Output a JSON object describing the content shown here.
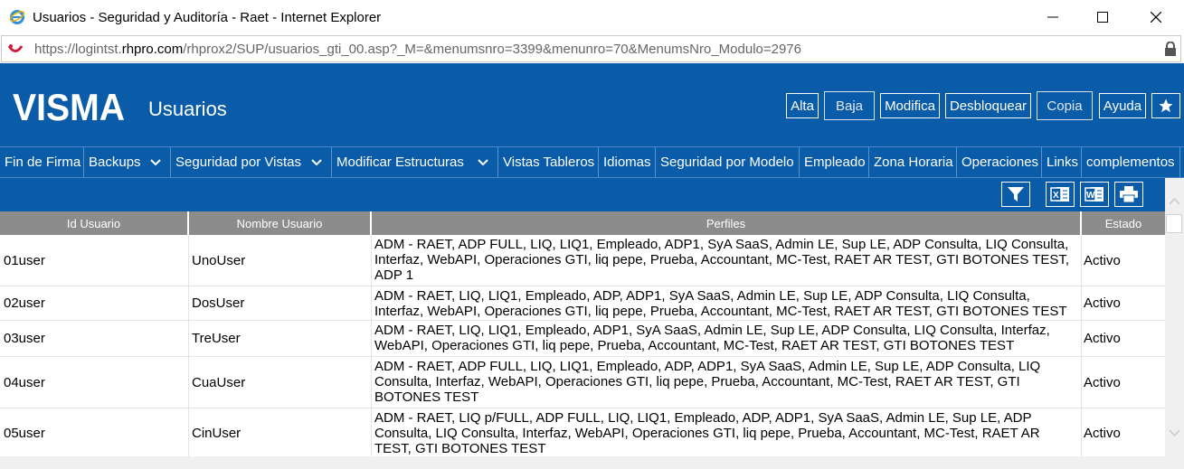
{
  "window": {
    "title": "Usuarios - Seguridad y Auditoría - Raet - Internet Explorer",
    "controls": [
      "minimize-icon",
      "maximize-icon",
      "close-icon"
    ]
  },
  "address": {
    "url_prefix": "https://logintst.",
    "url_host": "rhpro.com",
    "url_rest": "/rhprox2/SUP/usuarios_gti_00.asp?_M=&menumsnro=3399&menunro=70&MenumsNro_Modulo=2976",
    "icon": "site-icon",
    "lock_icon": "lock-icon"
  },
  "header": {
    "logo": "VISMA",
    "title": "Usuarios",
    "buttons": {
      "alta": "Alta",
      "baja": "Baja",
      "modifica": "Modifica",
      "desbloquear": "Desbloquear",
      "copia": "Copia",
      "ayuda": "Ayuda"
    },
    "favorite_icon": "star-icon"
  },
  "nav": {
    "items": [
      {
        "label": "Fin de Firma"
      },
      {
        "label": "Backups"
      },
      {
        "label": "Seguridad por Vistas"
      },
      {
        "label": "Modificar Estructuras"
      },
      {
        "label": "Vistas Tableros"
      },
      {
        "label": "Idiomas"
      },
      {
        "label": "Seguridad por Modelo"
      },
      {
        "label": "Empleado"
      },
      {
        "label": "Zona Horaria"
      },
      {
        "label": "Operaciones"
      },
      {
        "label": "Links"
      },
      {
        "label": "complementos"
      }
    ]
  },
  "toolbar": {
    "icons": [
      "filter-icon",
      "excel-icon",
      "word-icon",
      "print-icon"
    ]
  },
  "table": {
    "columns": [
      "Id Usuario",
      "Nombre Usuario",
      "Perfiles",
      "Estado"
    ],
    "rows": [
      {
        "id": "01user",
        "name": "UnoUser",
        "perfiles": "ADM - RAET, ADP FULL, LIQ, LIQ1, Empleado, ADP1, SyA SaaS, Admin LE, Sup LE, ADP Consulta, LIQ Consulta, Interfaz, WebAPI, Operaciones GTI, liq pepe, Prueba, Accountant, MC-Test, RAET AR TEST, GTI BOTONES TEST, ADP 1",
        "estado": "Activo"
      },
      {
        "id": "02user",
        "name": "DosUser",
        "perfiles": "ADM - RAET, LIQ, LIQ1, Empleado, ADP, ADP1, SyA SaaS, Admin LE, Sup LE, ADP Consulta, LIQ Consulta, Interfaz, WebAPI, Operaciones GTI, liq pepe, Prueba, Accountant, MC-Test, RAET AR TEST, GTI BOTONES TEST",
        "estado": "Activo"
      },
      {
        "id": "03user",
        "name": "TreUser",
        "perfiles": "ADM - RAET, LIQ, LIQ1, Empleado, ADP1, SyA SaaS, Admin LE, Sup LE, ADP Consulta, LIQ Consulta, Interfaz, WebAPI, Operaciones GTI, liq pepe, Prueba, Accountant, MC-Test, RAET AR TEST, GTI BOTONES TEST",
        "estado": "Activo"
      },
      {
        "id": "04user",
        "name": "CuaUser",
        "perfiles": "ADM - RAET, ADP FULL, LIQ, LIQ1, Empleado, ADP, ADP1, SyA SaaS, Admin LE, Sup LE, ADP Consulta, LIQ Consulta, Interfaz, WebAPI, Operaciones GTI, liq pepe, Prueba, Accountant, MC-Test, RAET AR TEST, GTI BOTONES TEST",
        "estado": "Activo"
      },
      {
        "id": "05user",
        "name": "CinUser",
        "perfiles": "ADM - RAET, LIQ p/FULL, ADP FULL, LIQ, LIQ1, Empleado, ADP, ADP1, SyA SaaS, Admin LE, Sup LE, ADP Consulta, LIQ Consulta, Interfaz, WebAPI, Operaciones GTI, liq pepe, Prueba, Accountant, MC-Test, RAET AR TEST, GTI BOTONES TEST",
        "estado": "Activo"
      }
    ]
  },
  "colors": {
    "brand_blue": "#0a5ca8",
    "header_gray": "#8c8c8c"
  }
}
